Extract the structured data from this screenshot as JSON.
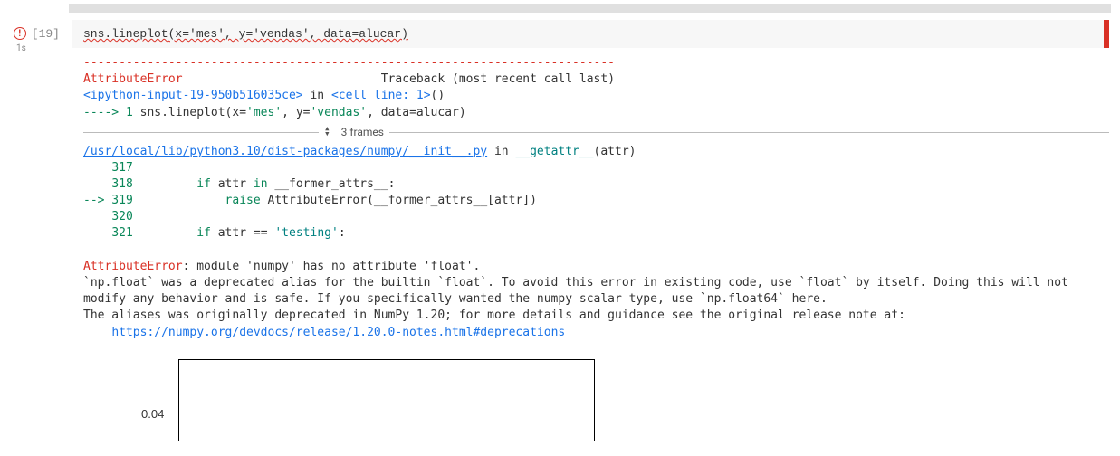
{
  "gutter": {
    "exec_count": "[19]",
    "exec_time": "1s"
  },
  "code": {
    "line1_pre": "sns.lineplot",
    "line1_args": "(x='mes', y='vendas', data=alucar)"
  },
  "traceback": {
    "dash": "---------------------------------------------------------------------------",
    "error_name": "AttributeError",
    "traceback_label": "Traceback (most recent call last)",
    "ipython_link": "<ipython-input-19-950b516035ce>",
    "in_cell": " in ",
    "cell_line": "<cell line: 1>",
    "cell_suffix": "()",
    "arrow_line": "----> 1 ",
    "code_echo": "sns.lineplot(x='mes', y='vendas', data=alucar)",
    "frames_label": "3 frames",
    "numpy_path": "/usr/local/lib/python3.10/dist-packages/numpy/__init__.py",
    "numpy_in": " in ",
    "numpy_func": "__getattr__",
    "numpy_func_arg": "(attr)",
    "lines": {
      "l317": "    317 ",
      "l318": "    318         if attr in __former_attrs__:",
      "l319p": "--> 319             raise AttributeError(__former_attrs__[attr])",
      "l320": "    320 ",
      "l321": "    321         if attr == 'testing':"
    },
    "final_error": "AttributeError",
    "final_msg": ": module 'numpy' has no attribute 'float'.",
    "explain1": "`np.float` was a deprecated alias for the builtin `float`. To avoid this error in existing code, use `float` by itself. Doing this will not modify any behavior and is safe. If you specifically wanted the numpy scalar type, use `np.float64` here.",
    "explain2": "The aliases was originally deprecated in NumPy 1.20; for more details and guidance see the original release note at:",
    "explain_link": "https://numpy.org/devdocs/release/1.20.0-notes.html#deprecations"
  },
  "plot": {
    "ytick": "0.04"
  }
}
